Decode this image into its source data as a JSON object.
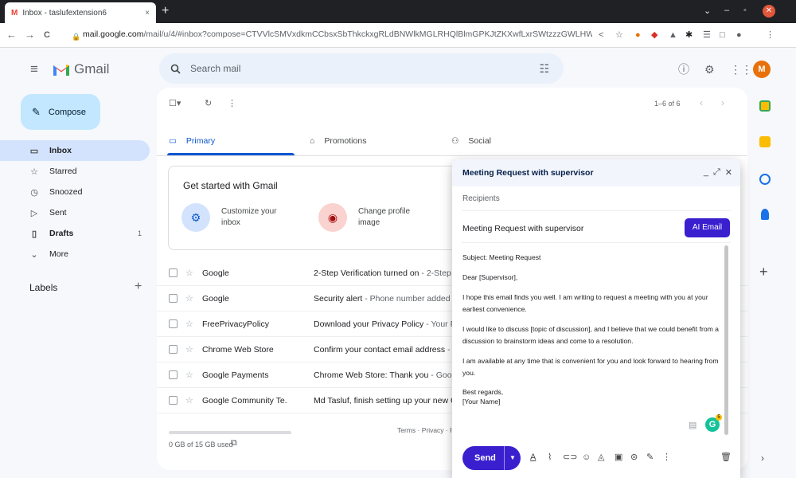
{
  "browser": {
    "tab_title": "Inbox - taslufextension6",
    "tab_close": "×",
    "new_tab": "+",
    "window_controls": [
      "⌄",
      "–",
      "◦"
    ],
    "window_close": "✕",
    "url_host": "mail.google.com",
    "url_path": "/mail/u/4/#inbox?compose=CTVVlcSMVxdkmCCbsxSbThkckxgRLdBNWlkMGLRHQlBlmGPKJtZKXwfLxrSWtzzzGWLHWQS...",
    "nav": {
      "back": "←",
      "forward": "→",
      "reload": "C"
    }
  },
  "gmail": {
    "logo_text": "Gmail",
    "search_placeholder": "Search mail",
    "avatar_letter": "M",
    "compose_label": "Compose",
    "nav_items": [
      {
        "label": "Inbox",
        "icon": "inbox-icon",
        "count": ""
      },
      {
        "label": "Starred",
        "icon": "star-icon",
        "count": ""
      },
      {
        "label": "Snoozed",
        "icon": "clock-icon",
        "count": ""
      },
      {
        "label": "Sent",
        "icon": "send-icon",
        "count": ""
      },
      {
        "label": "Drafts",
        "icon": "draft-icon",
        "count": "1"
      },
      {
        "label": "More",
        "icon": "chevron-down-icon",
        "count": ""
      }
    ],
    "labels_heading": "Labels",
    "labels_add": "+",
    "pager": "1–6 of 6",
    "tabs": [
      {
        "label": "Primary",
        "icon": "inbox-icon"
      },
      {
        "label": "Promotions",
        "icon": "tag-icon"
      },
      {
        "label": "Social",
        "icon": "people-icon"
      }
    ],
    "get_started": {
      "title": "Get started with Gmail",
      "items": [
        {
          "label": "Customize your inbox",
          "icon": "settings-icon",
          "color": "#d3e3fd"
        },
        {
          "label": "Change profile image",
          "icon": "profile-icon",
          "color": "#fad2cf"
        }
      ]
    },
    "emails": [
      {
        "sender": "Google",
        "subject": "2-Step Verification turned on",
        "snippet": " - 2-Step V"
      },
      {
        "sender": "Google",
        "subject": "Security alert",
        "snippet": " - Phone number added fo"
      },
      {
        "sender": "FreePrivacyPolicy",
        "subject": "Download your Privacy Policy",
        "snippet": " - Your Pri"
      },
      {
        "sender": "Chrome Web Store",
        "subject": "Confirm your contact email address",
        "snippet": " - D"
      },
      {
        "sender": "Google Payments",
        "subject": "Chrome Web Store: Thank you",
        "snippet": " - Google"
      },
      {
        "sender": "Google Community Te.",
        "subject": "Md Tasluf, finish setting up your new Go",
        "snippet": ""
      }
    ],
    "storage_text": "0 GB of 15 GB used",
    "terms_text": "Terms · Privacy · P"
  },
  "compose_window": {
    "title": "Meeting Request with supervisor",
    "controls": [
      "_",
      "⤢",
      "✕"
    ],
    "recipients_placeholder": "Recipients",
    "subject": "Meeting Request with supervisor",
    "ai_button": "AI Email",
    "body": [
      "Subject: Meeting Request",
      "Dear [Supervisor],",
      "I hope this email finds you well. I am writing to request a meeting with you at your earliest convenience.",
      "I would like to discuss [topic of discussion], and I believe that we could benefit from a discussion to brainstorm ideas and come to a resolution.",
      "I am available at any time that is convenient for you and look forward to hearing from you.",
      "Best regards,\n[Your Name]"
    ],
    "send_label": "Send",
    "grammarly_badge": "5"
  },
  "colors": {
    "accent": "#0b57d0",
    "compose_bg": "#c2e7ff",
    "ai_button": "#3a1fcf",
    "send_button": "#3a1fcf"
  }
}
